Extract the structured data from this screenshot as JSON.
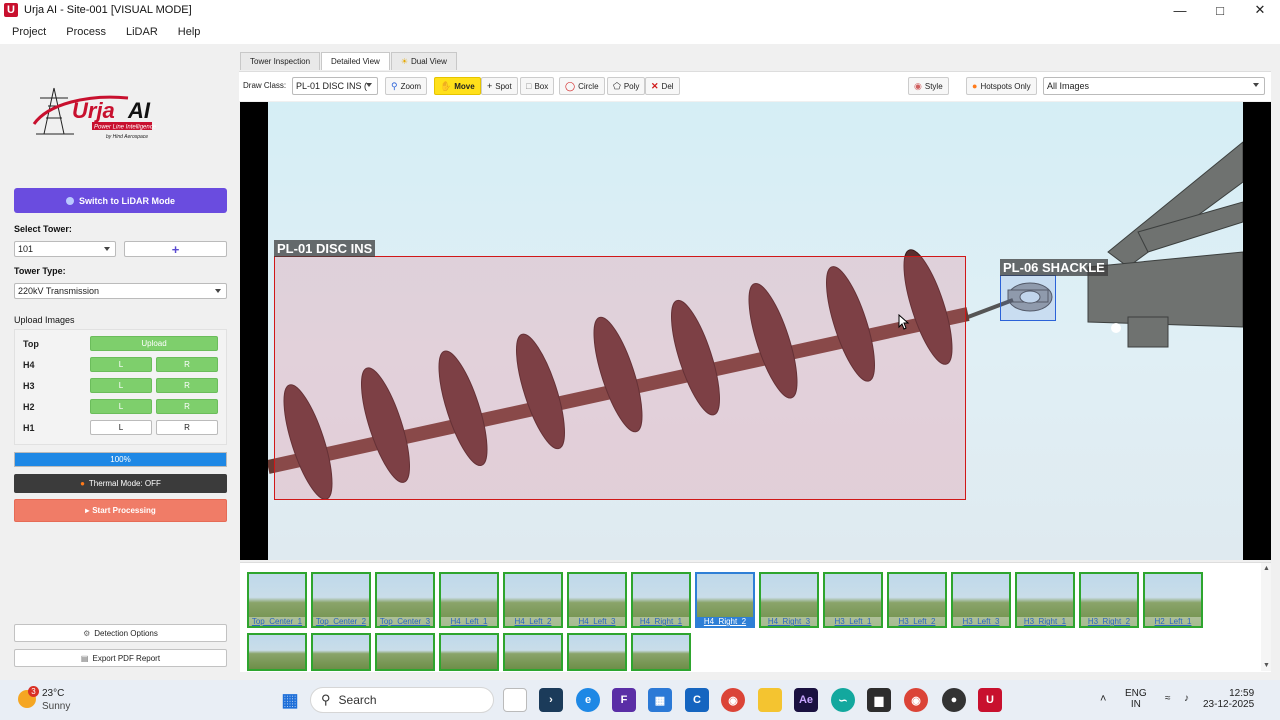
{
  "window": {
    "title": "Urja AI - Site-001 [VISUAL MODE]",
    "app_icon": "U"
  },
  "menu": [
    "Project",
    "Process",
    "LiDAR",
    "Help"
  ],
  "brand": {
    "name": "Urja AI",
    "tagline": "Power Line Intelligence",
    "by": "by Hind Aerospace"
  },
  "left": {
    "lidar_button": "Switch to LiDAR Mode",
    "select_tower_label": "Select Tower:",
    "tower_value": "101",
    "add_button": "+",
    "tower_type_label": "Tower Type:",
    "tower_type_value": "220kV Transmission",
    "upload_images_label": "Upload Images",
    "upload_rows": [
      {
        "label": "Top",
        "single": "Upload"
      },
      {
        "label": "H4",
        "l": "L",
        "r": "R"
      },
      {
        "label": "H3",
        "l": "L",
        "r": "R"
      },
      {
        "label": "H2",
        "l": "L",
        "r": "R"
      },
      {
        "label": "H1",
        "l": "L",
        "r": "R"
      }
    ],
    "progress": {
      "text": "100%",
      "value": 1.0
    },
    "thermal_button": "Thermal Mode: OFF",
    "start_button": "Start Processing",
    "detection_button": "Detection Options",
    "export_button": "Export PDF Report"
  },
  "tabs": [
    "Tower Inspection",
    "Detailed View",
    "Dual View"
  ],
  "toolbar": {
    "draw_class_label": "Draw Class:",
    "draw_class_value": "PL-01 DISC INS (",
    "zoom": "Zoom",
    "move": "Move",
    "spot": "Spot",
    "box": "Box",
    "circle": "Circle",
    "poly": "Poly",
    "del": "Del",
    "style": "Style",
    "hotspots": "Hotspots Only",
    "filter_value": "All Images"
  },
  "annotations": [
    {
      "label": "PL-01 DISC INS"
    },
    {
      "label": "PL-06 SHACKLE"
    }
  ],
  "thumbnails": [
    "Top_Center_1",
    "Top_Center_2",
    "Top_Center_3",
    "H4_Left_1",
    "H4_Left_2",
    "H4_Left_3",
    "H4_Right_1",
    "H4_Right_2",
    "H4_Right_3",
    "H3_Left_1",
    "H3_Left_2",
    "H3_Left_3",
    "H3_Right_1",
    "H3_Right_2",
    "H2_Left_1"
  ],
  "selected_thumbnail": "H4_Right_2",
  "taskbar": {
    "weather_temp": "23°C",
    "weather_desc": "Sunny",
    "weather_badge": "3",
    "search_placeholder": "Search",
    "lang_top": "ENG",
    "lang_bottom": "IN",
    "time": "12:59",
    "date": "23-12-2025"
  }
}
